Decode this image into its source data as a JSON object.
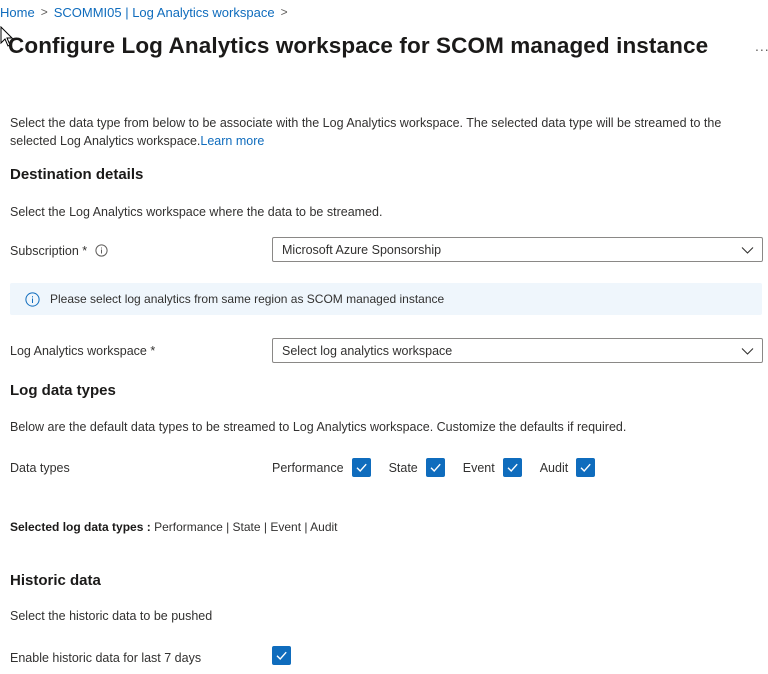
{
  "breadcrumb": [
    {
      "label": "Home"
    },
    {
      "label": "SCOMMI05 | Log Analytics workspace"
    }
  ],
  "page_title": "Configure Log Analytics workspace for SCOM managed instance",
  "more_label": "...",
  "description": {
    "text": "Select the data type from below to be associate with the Log Analytics workspace. The selected data type will be streamed to the selected Log Analytics workspace.",
    "link": "Learn more"
  },
  "destination": {
    "heading": "Destination details",
    "subtitle": "Select the Log Analytics workspace where the data to be streamed.",
    "subscription_label": "Subscription *",
    "subscription_value": "Microsoft Azure Sponsorship",
    "info_message": "Please select log analytics from same region as SCOM managed instance",
    "workspace_label": "Log Analytics workspace *",
    "workspace_placeholder": "Select log analytics workspace"
  },
  "log_types": {
    "heading": "Log data types",
    "subtitle": "Below are the default data types to be streamed to Log Analytics workspace. Customize the defaults if required.",
    "data_types_label": "Data types",
    "items": [
      {
        "label": "Performance",
        "checked": true
      },
      {
        "label": "State",
        "checked": true
      },
      {
        "label": "Event",
        "checked": true
      },
      {
        "label": "Audit",
        "checked": true
      }
    ],
    "selected_label": "Selected log data types :",
    "selected_value": "Performance | State | Event | Audit"
  },
  "historic": {
    "heading": "Historic data",
    "subtitle": "Select the historic data to be pushed",
    "enable_label": "Enable historic data for last 7 days",
    "enable_checked": true
  },
  "colors": {
    "accent": "#0f6cbd",
    "info_background": "#eff6fc"
  },
  "icons": {
    "breadcrumb_separator": "chevron-right-icon",
    "dropdown": "chevron-down-icon",
    "info": "info-icon",
    "checkbox": "checkmark-icon"
  }
}
